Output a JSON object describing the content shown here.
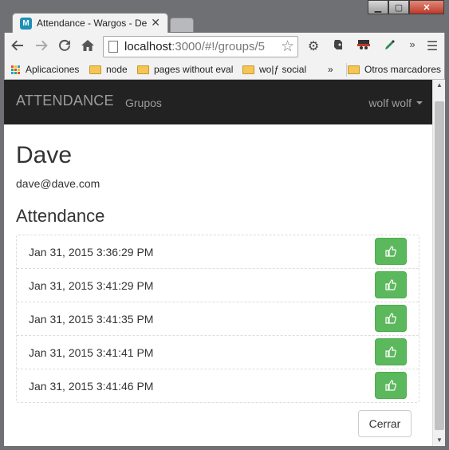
{
  "browser": {
    "tab_title": "Attendance - Wargos - De",
    "tab_favicon_letter": "M",
    "url_host": "localhost",
    "url_path": ":3000/#!/groups/5",
    "bookmarks_overflow": "»",
    "ext_overflow": "»",
    "bookmarks": [
      {
        "label": "Aplicaciones",
        "icon": "apps-grid-icon"
      },
      {
        "label": "node",
        "icon": "folder-icon"
      },
      {
        "label": "pages without eval",
        "icon": "folder-icon"
      },
      {
        "label": "wo|ƒ social",
        "icon": "folder-icon"
      }
    ],
    "other_bookmarks": "Otros marcadores"
  },
  "navbar": {
    "brand": "ATTENDANCE",
    "link_groups": "Grupos",
    "user": "wolf wolf"
  },
  "person": {
    "name": "Dave",
    "email": "dave@dave.com"
  },
  "attendance": {
    "title": "Attendance",
    "records": [
      {
        "time": "Jan 31, 2015 3:36:29 PM"
      },
      {
        "time": "Jan 31, 2015 3:41:29 PM"
      },
      {
        "time": "Jan 31, 2015 3:41:35 PM"
      },
      {
        "time": "Jan 31, 2015 3:41:41 PM"
      },
      {
        "time": "Jan 31, 2015 3:41:46 PM"
      }
    ]
  },
  "footer": {
    "close_label": "Cerrar"
  },
  "colors": {
    "navbar_bg": "#222222",
    "success": "#5cb85c",
    "text": "#333333"
  }
}
